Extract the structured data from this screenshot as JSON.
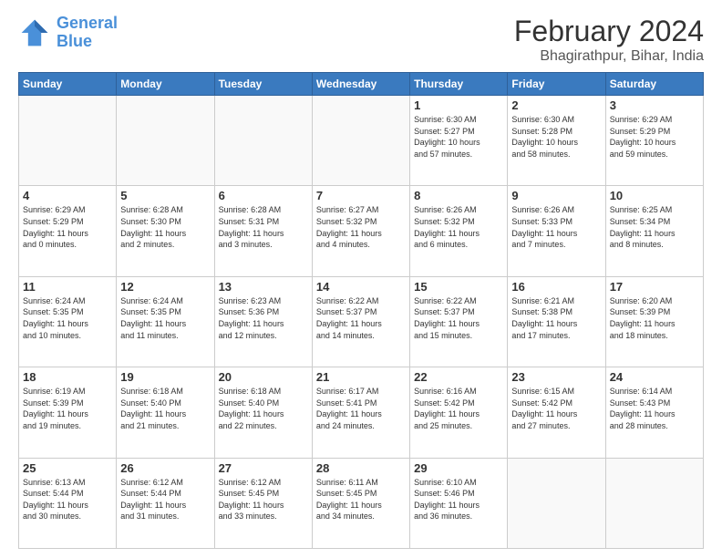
{
  "header": {
    "logo_line1": "General",
    "logo_line2": "Blue",
    "month_year": "February 2024",
    "location": "Bhagirathpur, Bihar, India"
  },
  "weekdays": [
    "Sunday",
    "Monday",
    "Tuesday",
    "Wednesday",
    "Thursday",
    "Friday",
    "Saturday"
  ],
  "weeks": [
    [
      {
        "day": "",
        "info": ""
      },
      {
        "day": "",
        "info": ""
      },
      {
        "day": "",
        "info": ""
      },
      {
        "day": "",
        "info": ""
      },
      {
        "day": "1",
        "info": "Sunrise: 6:30 AM\nSunset: 5:27 PM\nDaylight: 10 hours\nand 57 minutes."
      },
      {
        "day": "2",
        "info": "Sunrise: 6:30 AM\nSunset: 5:28 PM\nDaylight: 10 hours\nand 58 minutes."
      },
      {
        "day": "3",
        "info": "Sunrise: 6:29 AM\nSunset: 5:29 PM\nDaylight: 10 hours\nand 59 minutes."
      }
    ],
    [
      {
        "day": "4",
        "info": "Sunrise: 6:29 AM\nSunset: 5:29 PM\nDaylight: 11 hours\nand 0 minutes."
      },
      {
        "day": "5",
        "info": "Sunrise: 6:28 AM\nSunset: 5:30 PM\nDaylight: 11 hours\nand 2 minutes."
      },
      {
        "day": "6",
        "info": "Sunrise: 6:28 AM\nSunset: 5:31 PM\nDaylight: 11 hours\nand 3 minutes."
      },
      {
        "day": "7",
        "info": "Sunrise: 6:27 AM\nSunset: 5:32 PM\nDaylight: 11 hours\nand 4 minutes."
      },
      {
        "day": "8",
        "info": "Sunrise: 6:26 AM\nSunset: 5:32 PM\nDaylight: 11 hours\nand 6 minutes."
      },
      {
        "day": "9",
        "info": "Sunrise: 6:26 AM\nSunset: 5:33 PM\nDaylight: 11 hours\nand 7 minutes."
      },
      {
        "day": "10",
        "info": "Sunrise: 6:25 AM\nSunset: 5:34 PM\nDaylight: 11 hours\nand 8 minutes."
      }
    ],
    [
      {
        "day": "11",
        "info": "Sunrise: 6:24 AM\nSunset: 5:35 PM\nDaylight: 11 hours\nand 10 minutes."
      },
      {
        "day": "12",
        "info": "Sunrise: 6:24 AM\nSunset: 5:35 PM\nDaylight: 11 hours\nand 11 minutes."
      },
      {
        "day": "13",
        "info": "Sunrise: 6:23 AM\nSunset: 5:36 PM\nDaylight: 11 hours\nand 12 minutes."
      },
      {
        "day": "14",
        "info": "Sunrise: 6:22 AM\nSunset: 5:37 PM\nDaylight: 11 hours\nand 14 minutes."
      },
      {
        "day": "15",
        "info": "Sunrise: 6:22 AM\nSunset: 5:37 PM\nDaylight: 11 hours\nand 15 minutes."
      },
      {
        "day": "16",
        "info": "Sunrise: 6:21 AM\nSunset: 5:38 PM\nDaylight: 11 hours\nand 17 minutes."
      },
      {
        "day": "17",
        "info": "Sunrise: 6:20 AM\nSunset: 5:39 PM\nDaylight: 11 hours\nand 18 minutes."
      }
    ],
    [
      {
        "day": "18",
        "info": "Sunrise: 6:19 AM\nSunset: 5:39 PM\nDaylight: 11 hours\nand 19 minutes."
      },
      {
        "day": "19",
        "info": "Sunrise: 6:18 AM\nSunset: 5:40 PM\nDaylight: 11 hours\nand 21 minutes."
      },
      {
        "day": "20",
        "info": "Sunrise: 6:18 AM\nSunset: 5:40 PM\nDaylight: 11 hours\nand 22 minutes."
      },
      {
        "day": "21",
        "info": "Sunrise: 6:17 AM\nSunset: 5:41 PM\nDaylight: 11 hours\nand 24 minutes."
      },
      {
        "day": "22",
        "info": "Sunrise: 6:16 AM\nSunset: 5:42 PM\nDaylight: 11 hours\nand 25 minutes."
      },
      {
        "day": "23",
        "info": "Sunrise: 6:15 AM\nSunset: 5:42 PM\nDaylight: 11 hours\nand 27 minutes."
      },
      {
        "day": "24",
        "info": "Sunrise: 6:14 AM\nSunset: 5:43 PM\nDaylight: 11 hours\nand 28 minutes."
      }
    ],
    [
      {
        "day": "25",
        "info": "Sunrise: 6:13 AM\nSunset: 5:44 PM\nDaylight: 11 hours\nand 30 minutes."
      },
      {
        "day": "26",
        "info": "Sunrise: 6:12 AM\nSunset: 5:44 PM\nDaylight: 11 hours\nand 31 minutes."
      },
      {
        "day": "27",
        "info": "Sunrise: 6:12 AM\nSunset: 5:45 PM\nDaylight: 11 hours\nand 33 minutes."
      },
      {
        "day": "28",
        "info": "Sunrise: 6:11 AM\nSunset: 5:45 PM\nDaylight: 11 hours\nand 34 minutes."
      },
      {
        "day": "29",
        "info": "Sunrise: 6:10 AM\nSunset: 5:46 PM\nDaylight: 11 hours\nand 36 minutes."
      },
      {
        "day": "",
        "info": ""
      },
      {
        "day": "",
        "info": ""
      }
    ]
  ]
}
